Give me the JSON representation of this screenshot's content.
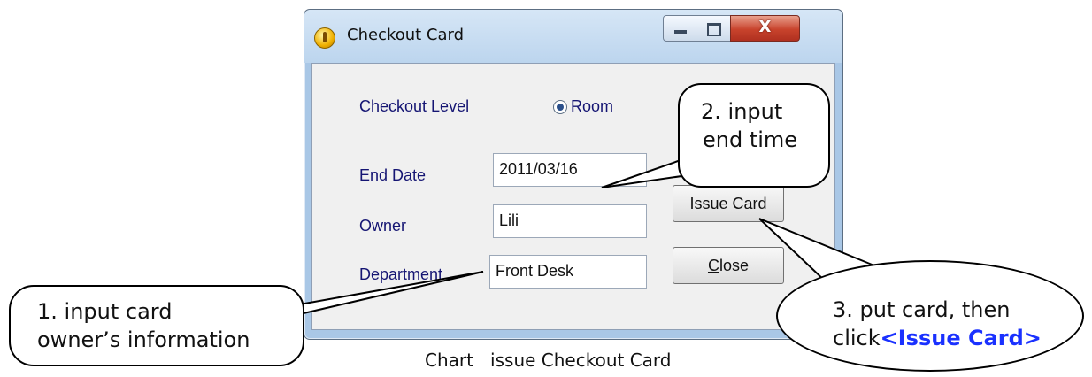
{
  "window": {
    "title": "Checkout Card",
    "close_glyph": "X",
    "icons": {
      "app": "key-icon",
      "minimize": "minimize-icon",
      "maximize": "maximize-icon",
      "close": "close-icon"
    }
  },
  "form": {
    "checkout_level_label": "Checkout Level",
    "radio_room_label": "Room",
    "end_date_label": "End Date",
    "end_date_value": "2011/03/16",
    "owner_label": "Owner",
    "owner_value": "Lili",
    "department_label": "Department",
    "department_value": "Front Desk",
    "issue_card_label": "Issue Card",
    "close_label_mnemonic": "C",
    "close_label_rest": "lose"
  },
  "callouts": {
    "step1_line1": "1. input card",
    "step1_line2": "owner’s information",
    "step2_line1": "2. input",
    "step2_line2": "end time",
    "step3_line1": "3. put card, then",
    "step3_prefix": "click",
    "step3_highlight": "<Issue Card>"
  },
  "caption": {
    "label": "Chart",
    "text": "issue Checkout Card"
  },
  "colors": {
    "label_text": "#151573",
    "highlight": "#1a31ff",
    "close_button": "#c8432c"
  }
}
